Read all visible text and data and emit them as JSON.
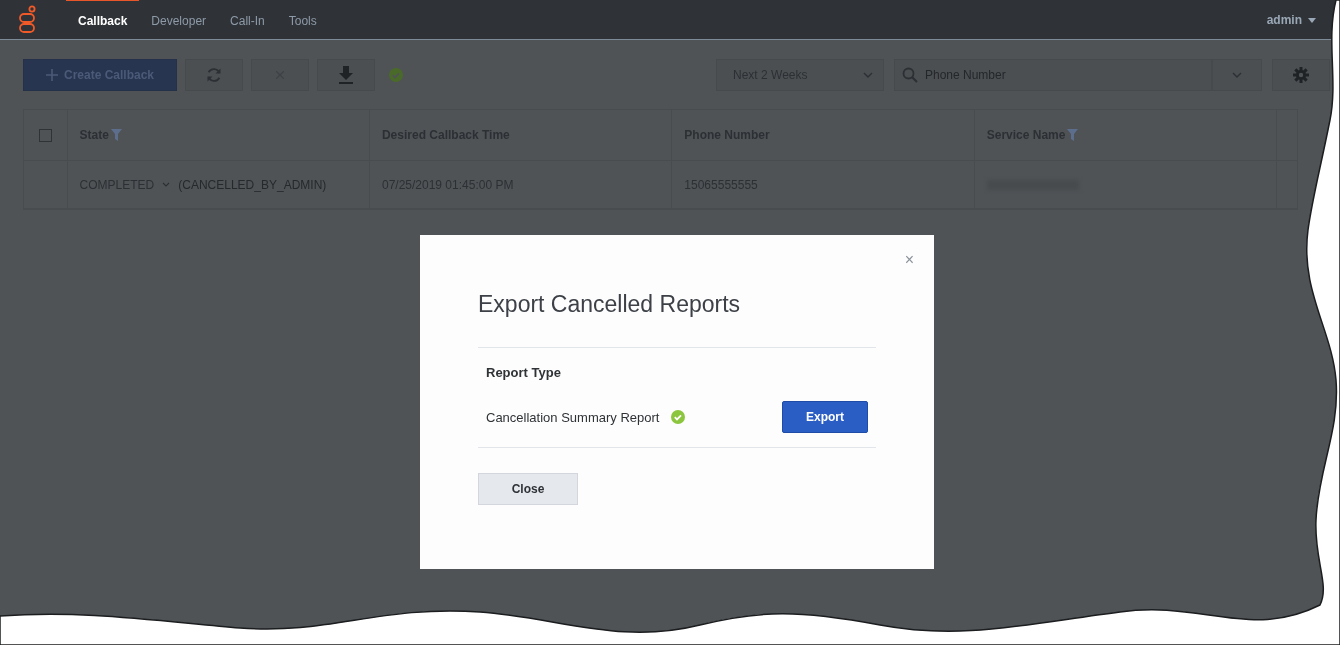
{
  "nav": {
    "tabs": [
      {
        "label": "Callback",
        "selected": true
      },
      {
        "label": "Developer",
        "selected": false
      },
      {
        "label": "Call-In",
        "selected": false
      },
      {
        "label": "Tools",
        "selected": false
      }
    ],
    "user": "admin"
  },
  "toolbar": {
    "create_label": "Create Callback",
    "range": "Next 2 Weeks",
    "search": {
      "placeholder": "Phone Number"
    }
  },
  "table": {
    "columns": [
      {
        "label": "State",
        "filter": true
      },
      {
        "label": "Desired Callback Time",
        "filter": false
      },
      {
        "label": "Phone Number",
        "filter": false
      },
      {
        "label": "Service Name",
        "filter": true
      }
    ],
    "select_all": {
      "checked": false
    },
    "rows": [
      {
        "state": "COMPLETED",
        "reason": "(CANCELLED_BY_ADMIN)",
        "time": "07/25/2019 01:45:00 PM",
        "phone": "15065555555"
      }
    ]
  },
  "modal": {
    "title": "Export Cancelled Reports",
    "close": "×",
    "heading": "Report Type",
    "reports": [
      {
        "name": "Cancellation Summary Report",
        "ready": true,
        "action": "Export"
      }
    ],
    "close_button": "Close"
  }
}
